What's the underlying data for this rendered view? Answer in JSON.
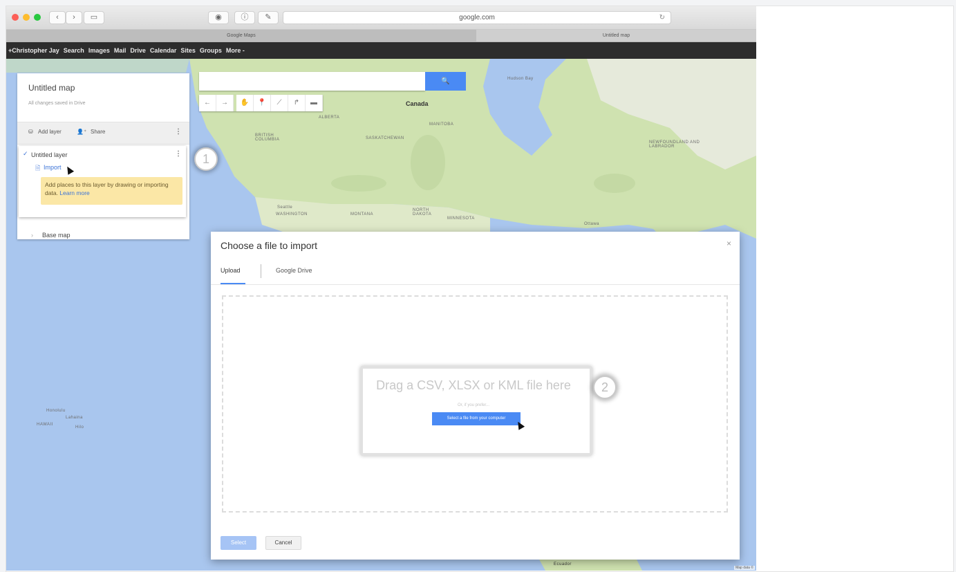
{
  "browser": {
    "address": "google.com",
    "tabs": [
      {
        "label": "Google Maps"
      },
      {
        "label": "Untitled map"
      }
    ]
  },
  "google_bar": {
    "items": [
      "+Christopher Jay",
      "Search",
      "Images",
      "Mail",
      "Drive",
      "Calendar",
      "Sites",
      "Groups",
      "More -"
    ]
  },
  "panel": {
    "title": "Untitled map",
    "subtitle": "All changes saved in Drive",
    "add_layer": "Add layer",
    "share": "Share",
    "layer_name": "Untitled layer",
    "import": "Import",
    "hint": "Add places to this layer by drawing or importing data.",
    "hint_link": "Learn more",
    "base_map": "Base map"
  },
  "map_labels": {
    "canada": "Canada",
    "hudson_bay": "Hudson Bay",
    "alberta": "ALBERTA",
    "british_columbia": "BRITISH COLUMBIA",
    "saskatchewan": "SASKATCHEWAN",
    "manitoba": "MANITOBA",
    "newfoundland": "NEWFOUNDLAND AND LABRADOR",
    "seattle": "Seattle",
    "washington": "WASHINGTON",
    "montana": "MONTANA",
    "north_dakota": "NORTH DAKOTA",
    "minnesota": "MINNESOTA",
    "honolulu": "Honolulu",
    "lahaina": "Lahaina",
    "hawaii": "HAWAII",
    "hilo": "Hilo",
    "ottawa": "Ottawa",
    "ecuador": "Ecuador",
    "map_data": "Map data ©"
  },
  "steps": [
    "1",
    "2"
  ],
  "dialog": {
    "title": "Choose a file to import",
    "close": "×",
    "tab_upload": "Upload",
    "tab_drive": "Google Drive",
    "drop_text": "Drag a CSV, XLSX or KML file here",
    "or": "Or, if you prefer...",
    "pick": "Select a file from your computer",
    "select": "Select",
    "cancel": "Cancel"
  },
  "colors": {
    "accent": "#4a8af4",
    "water": "#a9c6ee",
    "land": "#cfe2b0",
    "hint_bg": "#fbe7a6"
  }
}
